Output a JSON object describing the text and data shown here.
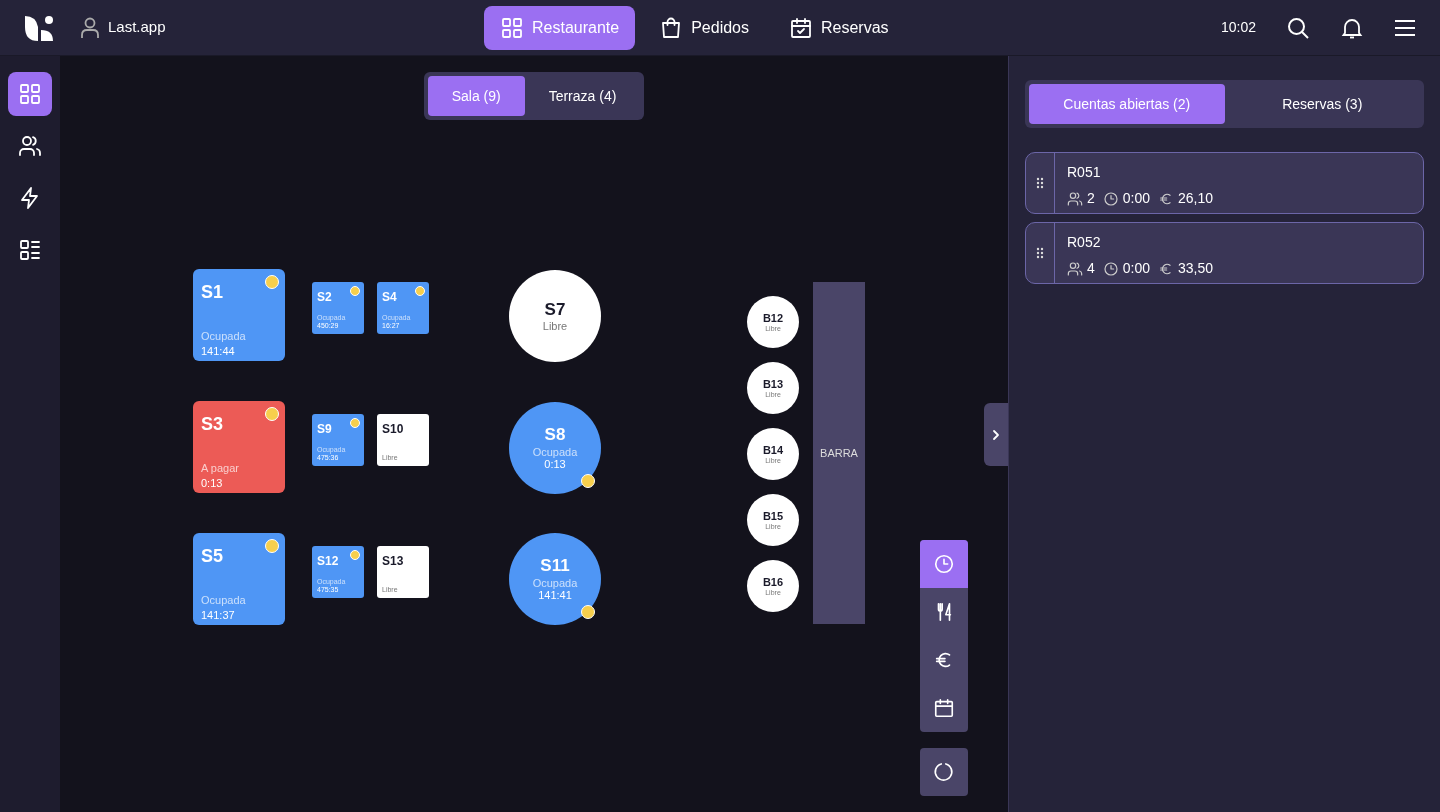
{
  "account": {
    "name": "Last.app"
  },
  "nav": [
    {
      "label": "Restaurante",
      "selected": true
    },
    {
      "label": "Pedidos",
      "selected": false
    },
    {
      "label": "Reservas",
      "selected": false
    }
  ],
  "clock": "10:02",
  "sidebar": {
    "items": [
      {
        "selected": true
      },
      {
        "selected": false
      },
      {
        "selected": false
      },
      {
        "selected": false
      }
    ]
  },
  "rooms": [
    {
      "label": "Sala (9)",
      "selected": true
    },
    {
      "label": "Terraza (4)",
      "selected": false
    }
  ],
  "tables": [
    {
      "name": "S1",
      "kind": "square",
      "color": "#4f96f5",
      "status": "Ocupada",
      "time": "141:44",
      "alert": true
    },
    {
      "name": "S2",
      "kind": "tile",
      "color": "#4f96f5",
      "status": "Ocupada",
      "time": "450:29",
      "alert": true
    },
    {
      "name": "S4",
      "kind": "tile",
      "color": "#4f96f5",
      "status": "Ocupada",
      "time": "16:27",
      "alert": true
    },
    {
      "name": "S7",
      "kind": "round",
      "color": "#ffffff",
      "status": "Libre",
      "alert": false
    },
    {
      "name": "S3",
      "kind": "square",
      "color": "#ec5b56",
      "status": "A pagar",
      "time": "0:13",
      "alert": true
    },
    {
      "name": "S9",
      "kind": "tile",
      "color": "#4f96f5",
      "status": "Ocupada",
      "time": "475:36",
      "alert": true
    },
    {
      "name": "S10",
      "kind": "tile",
      "color": "#ffffff",
      "status": "Libre",
      "alert": false
    },
    {
      "name": "S8",
      "kind": "round",
      "color": "#4f96f5",
      "status": "Ocupada",
      "time": "0:13",
      "alert": true
    },
    {
      "name": "S5",
      "kind": "square",
      "color": "#4f96f5",
      "status": "Ocupada",
      "time": "141:37",
      "alert": true
    },
    {
      "name": "S12",
      "kind": "tile",
      "color": "#4f96f5",
      "status": "Ocupada",
      "time": "475:35",
      "alert": true
    },
    {
      "name": "S13",
      "kind": "tile",
      "color": "#ffffff",
      "status": "Libre",
      "alert": false
    },
    {
      "name": "S11",
      "kind": "round",
      "color": "#4f96f5",
      "status": "Ocupada",
      "time": "141:41",
      "alert": true
    },
    {
      "name": "B12",
      "kind": "stool",
      "color": "#ffffff",
      "status": "Libre",
      "alert": false
    },
    {
      "name": "B13",
      "kind": "stool",
      "color": "#ffffff",
      "status": "Libre",
      "alert": false
    },
    {
      "name": "B14",
      "kind": "stool",
      "color": "#ffffff",
      "status": "Libre",
      "alert": false
    },
    {
      "name": "B15",
      "kind": "stool",
      "color": "#ffffff",
      "status": "Libre",
      "alert": false
    },
    {
      "name": "B16",
      "kind": "stool",
      "color": "#ffffff",
      "status": "Libre",
      "alert": false
    }
  ],
  "bar": {
    "label": "BARRA"
  },
  "tools": [
    {
      "selected": true
    },
    {
      "selected": false
    },
    {
      "selected": false
    },
    {
      "selected": false
    }
  ],
  "panel": {
    "tabs": [
      {
        "label": "Cuentas abiertas (2)",
        "selected": true
      },
      {
        "label": "Reservas (3)",
        "selected": false
      }
    ],
    "accounts": [
      {
        "code": "R051",
        "guests": "2",
        "time": "0:00",
        "total": "26,10"
      },
      {
        "code": "R052",
        "guests": "4",
        "time": "0:00",
        "total": "33,50"
      }
    ]
  }
}
